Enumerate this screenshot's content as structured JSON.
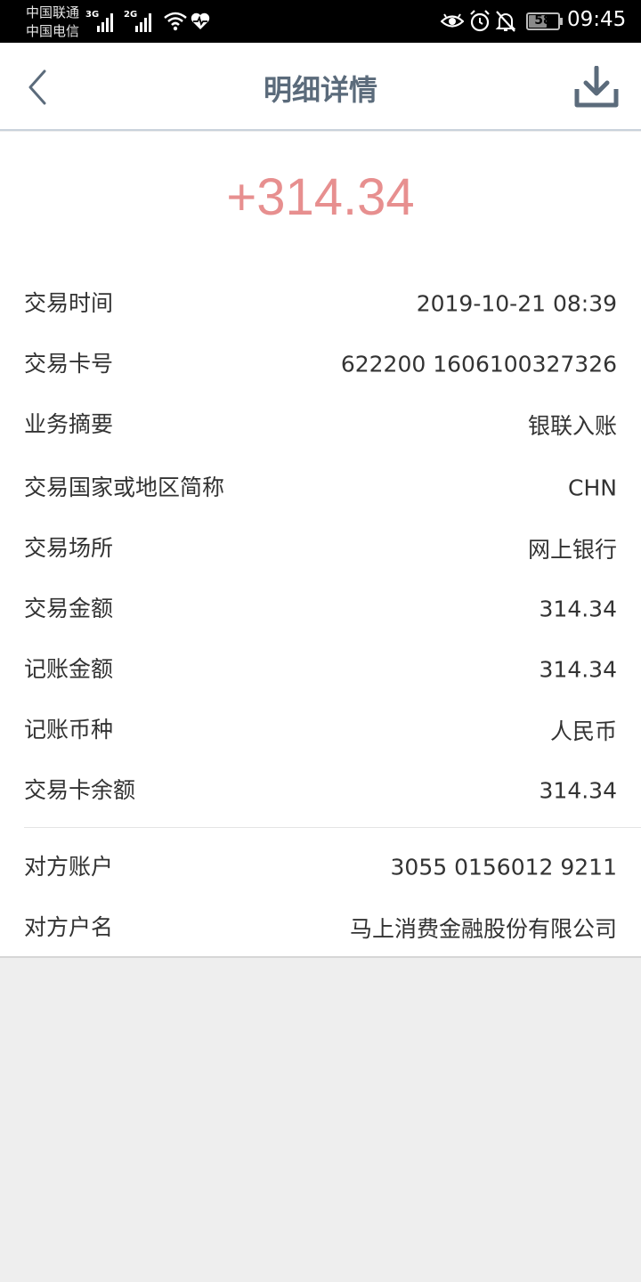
{
  "status_bar": {
    "carrier1": "中国联通",
    "carrier2": "中国电信",
    "signal1_gen": "3G",
    "signal2_gen": "2G",
    "battery": "58",
    "time": "09:45"
  },
  "nav": {
    "title": "明细详情",
    "back_icon": "chevron-left-icon",
    "download_icon": "download-icon"
  },
  "amount": "+314.34",
  "details": [
    {
      "label": "交易时间",
      "value": "2019-10-21 08:39"
    },
    {
      "label": "交易卡号",
      "value": "622200 1606100327326"
    },
    {
      "label": "业务摘要",
      "value": "银联入账"
    },
    {
      "label": "交易国家或地区简称",
      "value": "CHN"
    },
    {
      "label": "交易场所",
      "value": "网上银行"
    },
    {
      "label": "交易金额",
      "value": "314.34"
    },
    {
      "label": "记账金额",
      "value": "314.34"
    },
    {
      "label": "记账币种",
      "value": "人民币"
    },
    {
      "label": "交易卡余额",
      "value": "314.34"
    }
  ],
  "counterparty": [
    {
      "label": "对方账户",
      "value": "3055 0156012 9211"
    },
    {
      "label": "对方户名",
      "value": "马上消费金融股份有限公司"
    }
  ],
  "colors": {
    "amount": "#e78f8f",
    "title": "#5b6b7b",
    "background": "#eeeeee"
  }
}
